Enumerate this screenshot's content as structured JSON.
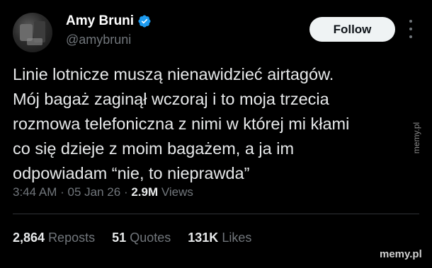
{
  "author": {
    "display_name": "Amy Bruni",
    "handle": "@amybruni",
    "verified": true,
    "verified_color": "#1d9bf0"
  },
  "follow_button": {
    "label": "Follow"
  },
  "more_menu": {
    "icon": "more-vertical-icon"
  },
  "tweet": {
    "lines": [
      "Linie lotnicze muszą nienawidzieć airtagów.",
      "Mój bagaż zaginął wczoraj i to moja trzecia",
      "rozmowa telefoniczna z nimi w której mi kłami",
      "co się dzieje z moim bagażem, a ja im",
      "odpowiadam “nie, to nieprawda”"
    ]
  },
  "meta": {
    "time": "3:44 AM",
    "separator": "·",
    "date": "05 Jan 26",
    "views_count": "2.9M",
    "views_label": "Views"
  },
  "stats": {
    "reposts_count": "2,864",
    "reposts_label": "Reposts",
    "quotes_count": "51",
    "quotes_label": "Quotes",
    "likes_count": "131K",
    "likes_label": "Likes"
  },
  "watermarks": {
    "side": "memy.pl",
    "bottom": "memy.pl"
  }
}
